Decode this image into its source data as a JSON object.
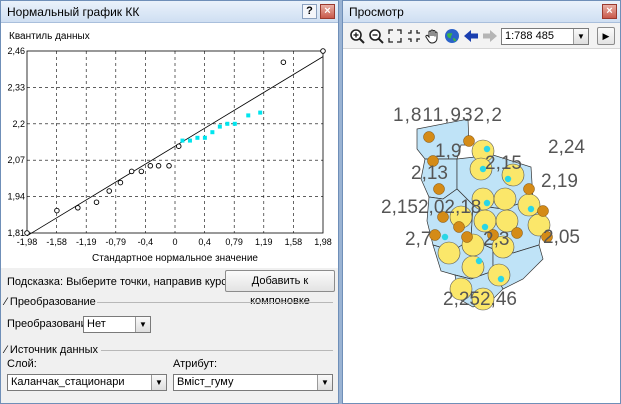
{
  "left_window": {
    "title": "Нормальный график КК",
    "help_button": "?",
    "close_button": "×"
  },
  "right_window": {
    "title": "Просмотр",
    "close_button": "×",
    "scale": "1:788 485",
    "dropdown_arrow": "▼",
    "play_arrow": "▶",
    "tools": [
      "zoom-in-icon",
      "zoom-out-icon",
      "full-extent-icon",
      "fixed-zoom-icon",
      "pan-hand-icon",
      "globe-icon",
      "back-arrow-icon",
      "forward-arrow-icon"
    ]
  },
  "chart_data": {
    "type": "scatter",
    "title": "",
    "ylabel": "Квантиль данных",
    "xlabel": "Стандартное нормальное значение",
    "x_ticks": [
      "-1,98",
      "-1,58",
      "-1,19",
      "-0,79",
      "-0,4",
      "0",
      "0,4",
      "0,79",
      "1,19",
      "1,58",
      "1,98"
    ],
    "y_ticks": [
      "1,81",
      "1,94",
      "2,07",
      "2,2",
      "2,33",
      "2,46"
    ],
    "xlim": [
      -1.98,
      1.98
    ],
    "ylim": [
      1.81,
      2.46
    ],
    "grid": true,
    "series": [
      {
        "color": "#000000",
        "marker": "open-circle",
        "x": [
          -1.98,
          -1.58,
          -1.3,
          -1.05,
          -0.88,
          -0.73,
          -0.58,
          -0.45,
          -0.33,
          -0.22,
          -0.08,
          0.05,
          1.45,
          1.98
        ],
        "y": [
          1.81,
          1.89,
          1.9,
          1.92,
          1.96,
          1.99,
          2.03,
          2.03,
          2.05,
          2.05,
          2.05,
          2.12,
          2.42,
          2.46
        ]
      },
      {
        "color": "#00e5ee",
        "marker": "filled-square",
        "x": [
          0.1,
          0.2,
          0.3,
          0.4,
          0.5,
          0.6,
          0.7,
          0.8,
          0.98,
          1.14
        ],
        "y": [
          2.14,
          2.14,
          2.15,
          2.15,
          2.17,
          2.19,
          2.2,
          2.2,
          2.23,
          2.24
        ]
      }
    ],
    "trend_line": {
      "x": [
        -1.98,
        1.98
      ],
      "y": [
        1.8,
        2.44
      ]
    }
  },
  "form": {
    "hint_label": "Подсказка:",
    "hint_text": "Выберите точки, направив курсор и",
    "add_button": "Добавить к компоновке",
    "transform_section": "Преобразование",
    "transform_label": "Преобразование:",
    "transform_value": "Нет",
    "source_section": "Источник данных",
    "layer_label": "Слой:",
    "layer_value": "Каланчак_стационари",
    "attribute_label": "Атрибут:",
    "attribute_value": "Вміст_гуму",
    "dropdown_arrow": "▼"
  },
  "map": {
    "labels": [
      {
        "text": "1,811,932,2"
      },
      {
        "text": "1,9"
      },
      {
        "text": "2,13"
      },
      {
        "text": "2,15"
      },
      {
        "text": "2,24"
      },
      {
        "text": "2,19"
      },
      {
        "text": "2,152,02,18"
      },
      {
        "text": "2,7"
      },
      {
        "text": "2,3"
      },
      {
        "text": "2,05"
      },
      {
        "text": "2,252,46"
      }
    ],
    "colors": {
      "polygon": "#bfe3f7",
      "large_point": "#fbe76a",
      "small_point": "#d48b17",
      "focus_point": "#2ad6e6"
    }
  }
}
